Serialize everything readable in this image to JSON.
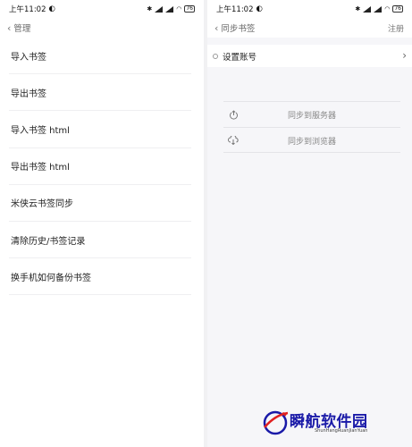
{
  "left_screen": {
    "status": {
      "time": "上午11:02",
      "battery": "76"
    },
    "nav": {
      "title": "管理"
    },
    "items": [
      {
        "label": "导入书签"
      },
      {
        "label": "导出书签"
      },
      {
        "label": "导入书签 html"
      },
      {
        "label": "导出书签 html"
      },
      {
        "label": "米侠云书签同步"
      },
      {
        "label": "清除历史/书签记录"
      },
      {
        "label": "换手机如何备份书签"
      }
    ]
  },
  "right_screen": {
    "status": {
      "time": "上午11:02",
      "battery": "76"
    },
    "nav": {
      "title": "同步书签",
      "action": "注册"
    },
    "settings": {
      "label": "设置账号"
    },
    "sync_actions": [
      {
        "label": "同步到服务器",
        "icon": "upload-icon"
      },
      {
        "label": "同步到浏览器",
        "icon": "cloud-download-icon"
      }
    ]
  },
  "watermark": {
    "title": "瞬航软件园",
    "subtitle": "ShunHangRuanJianYuan"
  }
}
